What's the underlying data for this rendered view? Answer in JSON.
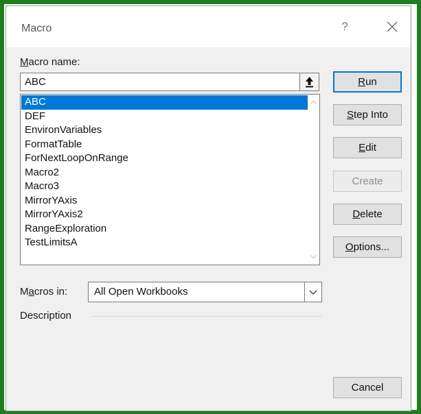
{
  "dialog": {
    "title": "Macro",
    "help_label": "?"
  },
  "macro_name": {
    "label_accel": "M",
    "label_rest": "acro name:",
    "value": "ABC"
  },
  "macros": [
    {
      "name": "ABC",
      "selected": true
    },
    {
      "name": "DEF"
    },
    {
      "name": "EnvironVariables"
    },
    {
      "name": "FormatTable"
    },
    {
      "name": "ForNextLoopOnRange"
    },
    {
      "name": "Macro2"
    },
    {
      "name": "Macro3"
    },
    {
      "name": "MirrorYAxis"
    },
    {
      "name": "MirrorYAxis2"
    },
    {
      "name": "RangeExploration"
    },
    {
      "name": "TestLimitsA"
    }
  ],
  "buttons": {
    "run": {
      "accel": "R",
      "rest": "un"
    },
    "step_into": {
      "accel": "S",
      "rest": "tep Into"
    },
    "edit": {
      "accel": "E",
      "rest": "dit"
    },
    "create": {
      "label": "Create"
    },
    "delete": {
      "accel": "D",
      "rest": "elete"
    },
    "options": {
      "accel": "O",
      "rest": "ptions..."
    },
    "cancel": {
      "label": "Cancel"
    }
  },
  "macros_in": {
    "label_pre": "M",
    "label_accel": "a",
    "label_rest": "cros in:",
    "value": "All Open Workbooks"
  },
  "description": {
    "label": "Description"
  },
  "colors": {
    "frame": "#1e7e1e",
    "selection": "#0078d7",
    "default_button_border": "#0078d7"
  }
}
